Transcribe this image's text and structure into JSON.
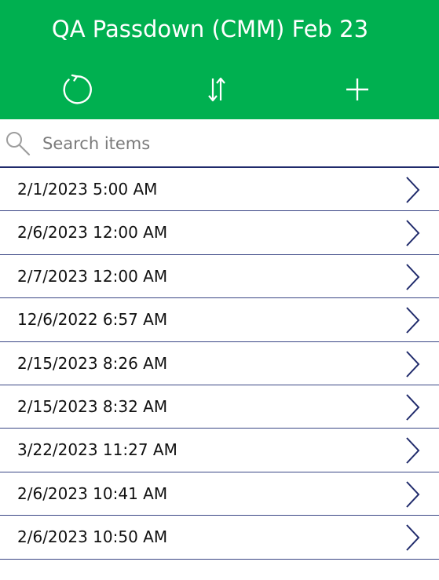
{
  "header": {
    "title": "QA Passdown (CMM) Feb 23",
    "background_color": "#00b050",
    "icons": {
      "refresh": "refresh-icon",
      "sort": "sort-icon",
      "add": "add-icon"
    }
  },
  "search": {
    "placeholder": "Search items",
    "value": "",
    "icon": "search-icon"
  },
  "list": {
    "divider_color": "#3a4685",
    "chevron_icon": "chevron-right-icon",
    "items": [
      {
        "label": "2/1/2023 5:00 AM"
      },
      {
        "label": "2/6/2023 12:00 AM"
      },
      {
        "label": "2/7/2023 12:00 AM"
      },
      {
        "label": "12/6/2022 6:57 AM"
      },
      {
        "label": "2/15/2023 8:26 AM"
      },
      {
        "label": "2/15/2023 8:32 AM"
      },
      {
        "label": "3/22/2023 11:27 AM"
      },
      {
        "label": "2/6/2023 10:41 AM"
      },
      {
        "label": "2/6/2023 10:50 AM"
      }
    ]
  }
}
